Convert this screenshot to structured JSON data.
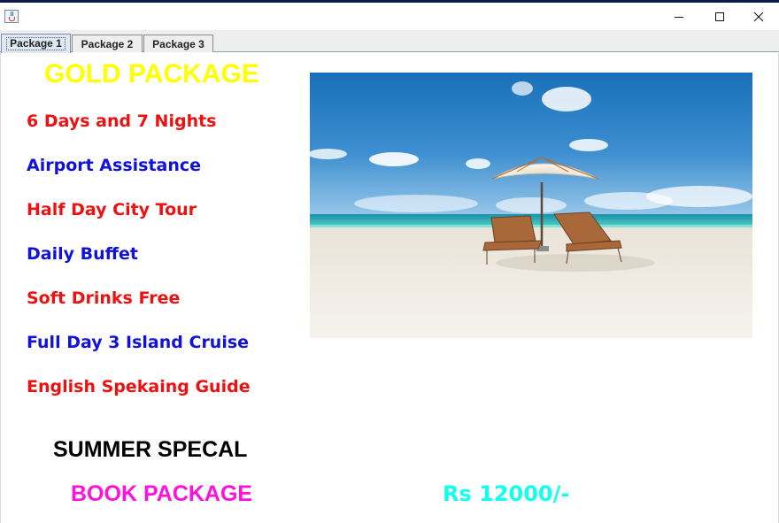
{
  "window": {
    "icon": "java-cup-icon",
    "controls": [
      "minimize-icon",
      "maximize-icon",
      "close-icon"
    ]
  },
  "tabs": [
    {
      "label": "Package 1",
      "selected": true
    },
    {
      "label": "Package 2",
      "selected": false
    },
    {
      "label": "Package 3",
      "selected": false
    }
  ],
  "package": {
    "title": "GOLD PACKAGE",
    "title_color": "#ffff00",
    "features": [
      {
        "text": "6 Days and 7 Nights",
        "color": "#ee1111"
      },
      {
        "text": "Airport Assistance",
        "color": "#1111dd"
      },
      {
        "text": "Half Day City Tour",
        "color": "#ee1111"
      },
      {
        "text": "Daily Buffet",
        "color": "#1111dd"
      },
      {
        "text": "Soft Drinks Free",
        "color": "#ee1111"
      },
      {
        "text": "Full Day 3 Island Cruise",
        "color": "#1111dd"
      },
      {
        "text": "English Spekaing Guide",
        "color": "#ee1111"
      }
    ],
    "promo": "SUMMER SPECAL",
    "promo_color": "#000000",
    "book_label": "BOOK PACKAGE",
    "book_color": "#ff11dd",
    "price": "Rs 12000/-",
    "price_color": "#11ffee",
    "image": "beach-with-umbrella-and-loungers"
  }
}
